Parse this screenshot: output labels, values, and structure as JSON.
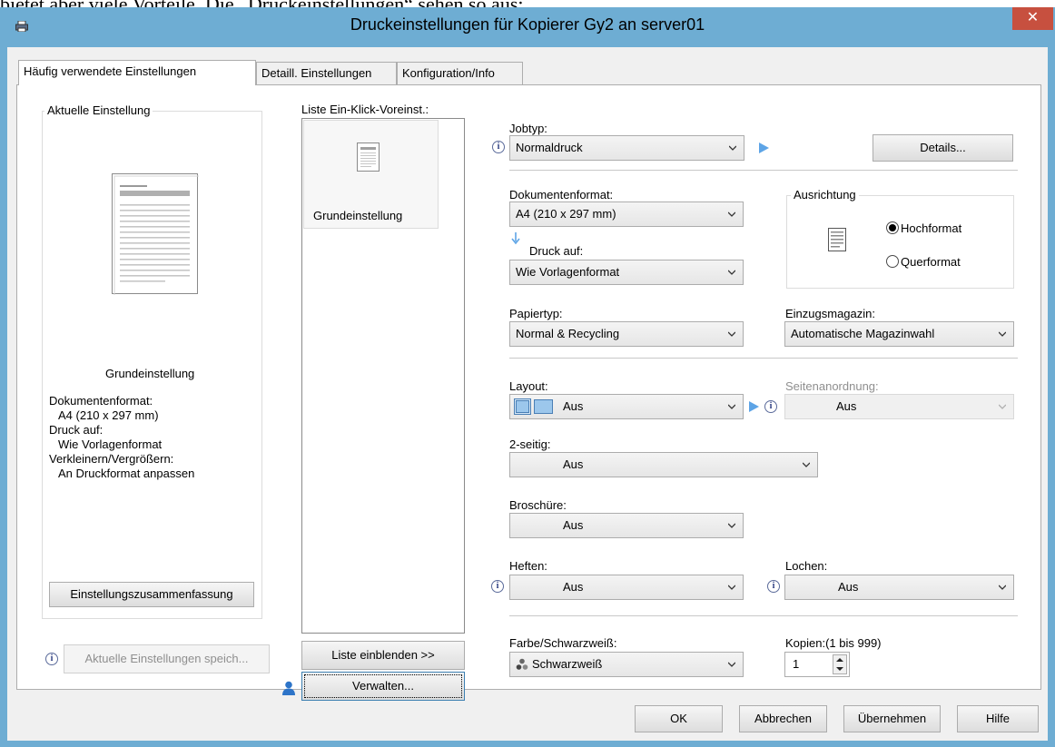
{
  "background_text": "bietet aber viele Vorteile. Die „Druckeinstellungen“ sehen so aus:",
  "window": {
    "title": "Druckeinstellungen für Kopierer Gy2 an server01",
    "close_label": "✕"
  },
  "tabs": [
    {
      "label": "Häufig verwendete Einstellungen",
      "active": true
    },
    {
      "label": "Detaill. Einstellungen",
      "active": false
    },
    {
      "label": "Konfiguration/Info",
      "active": false
    }
  ],
  "current_settings": {
    "legend": "Aktuelle Einstellung",
    "name": "Grundeinstellung",
    "summary": [
      "Dokumentenformat:",
      " A4 (210 x 297 mm)",
      "Druck auf:",
      " Wie Vorlagenformat",
      "Verkleinern/Vergrößern:",
      " An Druckformat anpassen"
    ],
    "summary_button": "Einstellungszusammenfassung",
    "save_button": "Aktuelle Einstellungen speich..."
  },
  "presets": {
    "label": "Liste Ein-Klick-Voreinst.:",
    "items": [
      "Grundeinstellung"
    ],
    "show_list_button": "Liste einblenden >>",
    "manage_button": "Verwalten..."
  },
  "settings": {
    "jobtyp": {
      "label": "Jobtyp:",
      "value": "Normaldruck"
    },
    "details_button": "Details...",
    "dokumentenformat": {
      "label": "Dokumentenformat:",
      "value": "A4 (210 x 297 mm)"
    },
    "druck_auf": {
      "label": "Druck auf:",
      "value": "Wie Vorlagenformat"
    },
    "ausrichtung": {
      "legend": "Ausrichtung",
      "options": [
        {
          "label": "Hochformat",
          "checked": true
        },
        {
          "label": "Querformat",
          "checked": false
        }
      ]
    },
    "papiertyp": {
      "label": "Papiertyp:",
      "value": "Normal & Recycling"
    },
    "einzugsmagazin": {
      "label": "Einzugsmagazin:",
      "value": "Automatische Magazinwahl"
    },
    "layout": {
      "label": "Layout:",
      "value": "Aus"
    },
    "seitenanordnung": {
      "label": "Seitenanordnung:",
      "value": "Aus"
    },
    "zweiseitig": {
      "label": "2-seitig:",
      "value": "Aus"
    },
    "broschuere": {
      "label": "Broschüre:",
      "value": "Aus"
    },
    "heften": {
      "label": "Heften:",
      "value": "Aus"
    },
    "lochen": {
      "label": "Lochen:",
      "value": "Aus"
    },
    "farbe": {
      "label": "Farbe/Schwarzweiß:",
      "value": "Schwarzweiß"
    },
    "kopien": {
      "label": "Kopien:(1 bis 999)",
      "value": "1"
    }
  },
  "footer": {
    "ok": "OK",
    "cancel": "Abbrechen",
    "apply": "Übernehmen",
    "help": "Hilfe"
  }
}
